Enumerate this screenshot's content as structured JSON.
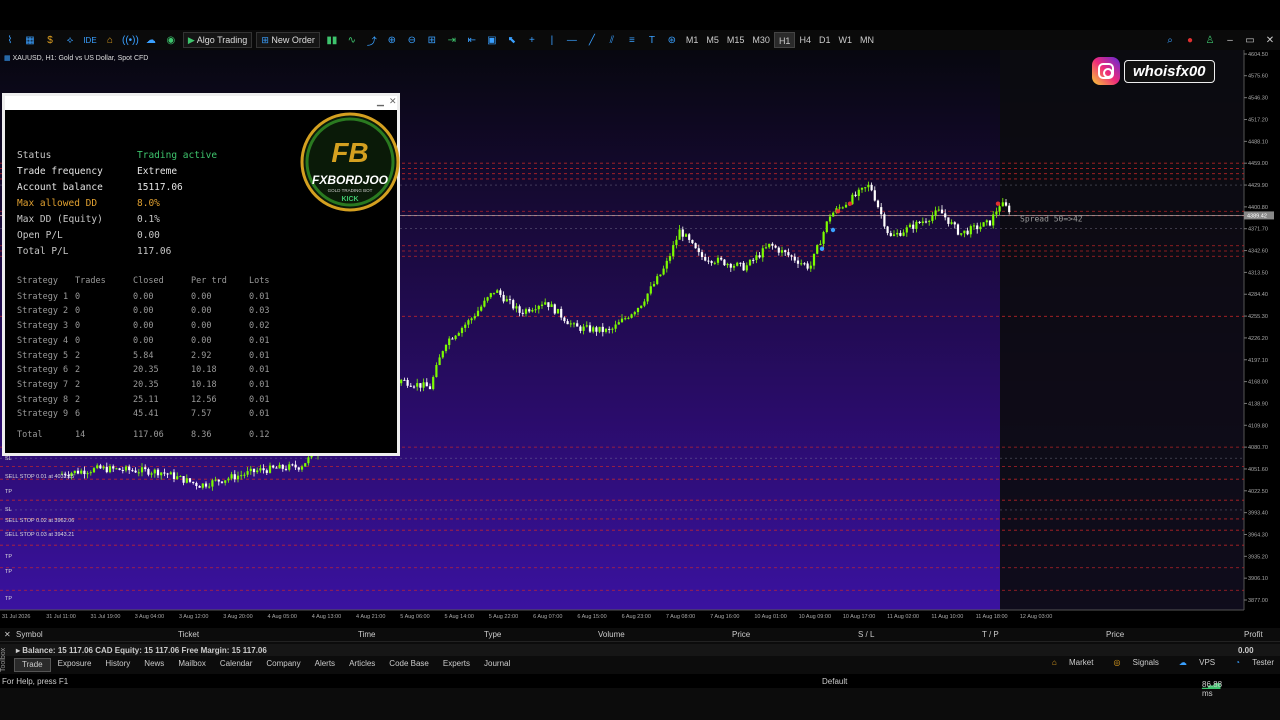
{
  "toolbar": {
    "algo_label": "Algo Trading",
    "neworder_label": "New Order",
    "timeframes": [
      "M1",
      "M5",
      "M15",
      "M30",
      "H1",
      "H4",
      "D1",
      "W1",
      "MN"
    ],
    "active_tf": "H1"
  },
  "chart": {
    "symbol_info": "XAUUSD, H1:  Gold vs US Dollar, Spot CFD",
    "price_ticks": [
      "4604.50",
      "4575.60",
      "4546.30",
      "4517.20",
      "4488.10",
      "4459.00",
      "4429.90",
      "4400.80",
      "4371.70",
      "4342.60",
      "4313.50",
      "4284.40",
      "4255.30",
      "4226.20",
      "4197.10",
      "4168.00",
      "4138.90",
      "4109.80",
      "4080.70",
      "4051.60",
      "4022.50",
      "3993.40",
      "3964.30",
      "3935.20",
      "3906.10",
      "3877.00"
    ],
    "current_price": "4389.42",
    "time_ticks": [
      "31 Jul 2026",
      "31 Jul 11:00",
      "31 Jul 19:00",
      "3 Aug 04:00",
      "3 Aug 12:00",
      "3 Aug 20:00",
      "4 Aug 05:00",
      "4 Aug 13:00",
      "4 Aug 21:00",
      "5 Aug 06:00",
      "5 Aug 14:00",
      "5 Aug 22:00",
      "6 Aug 07:00",
      "6 Aug 15:00",
      "6 Aug 23:00",
      "7 Aug 08:00",
      "7 Aug 16:00",
      "10 Aug 01:00",
      "10 Aug 09:00",
      "10 Aug 17:00",
      "11 Aug 02:00",
      "11 Aug 10:00",
      "11 Aug 18:00",
      "12 Aug 03:00"
    ],
    "spread_label": "Spread 50=>42",
    "order_labels": [
      "SL",
      "SELL STOP 0.01 at 4032.15",
      "TP",
      "SL",
      "SELL STOP 0.02 at 3962.06",
      "SELL STOP 0.03 at 3943.21",
      "TP",
      "TP",
      "TP"
    ],
    "instagram_handle": "whoisfx00"
  },
  "panel": {
    "stats": [
      {
        "k": "Status",
        "v": "Trading active",
        "color": "#c8c8c8",
        "vcolor": "#3ec46d"
      },
      {
        "k": "Trade frequency",
        "v": "Extreme",
        "color": "#e6e6e6",
        "vcolor": "#e6e6e6"
      },
      {
        "k": "Account balance",
        "v": "15117.06",
        "color": "#e6e6e6",
        "vcolor": "#e6e6e6"
      },
      {
        "k": "Max allowed DD",
        "v": "8.0%",
        "color": "#e0a030",
        "vcolor": "#e0a030"
      },
      {
        "k": "Max DD (Equity)",
        "v": "0.1%",
        "color": "#c8c8c8",
        "vcolor": "#c8c8c8"
      },
      {
        "k": "Open P/L",
        "v": "0.00",
        "color": "#c8c8c8",
        "vcolor": "#c8c8c8"
      },
      {
        "k": "Total P/L",
        "v": "117.06",
        "color": "#c8c8c8",
        "vcolor": "#c8c8c8"
      }
    ],
    "strat_headers": [
      "Strategy",
      "Trades",
      "Closed",
      "Per trd",
      "Lots"
    ],
    "strategies": [
      [
        "Strategy 1",
        "0",
        "0.00",
        "0.00",
        "0.01"
      ],
      [
        "Strategy 2",
        "0",
        "0.00",
        "0.00",
        "0.03"
      ],
      [
        "Strategy 3",
        "0",
        "0.00",
        "0.00",
        "0.02"
      ],
      [
        "Strategy 4",
        "0",
        "0.00",
        "0.00",
        "0.01"
      ],
      [
        "Strategy 5",
        "2",
        "5.84",
        "2.92",
        "0.01"
      ],
      [
        "Strategy 6",
        "2",
        "20.35",
        "10.18",
        "0.01"
      ],
      [
        "Strategy 7",
        "2",
        "20.35",
        "10.18",
        "0.01"
      ],
      [
        "Strategy 8",
        "2",
        "25.11",
        "12.56",
        "0.01"
      ],
      [
        "Strategy 9",
        "6",
        "45.41",
        "7.57",
        "0.01"
      ]
    ],
    "total_row": [
      "Total",
      "14",
      "117.06",
      "8.36",
      "0.12"
    ],
    "logo_text": "FXBORDJOO",
    "logo_sub": "GOLD TRADING BOT",
    "logo_kick": "KICK"
  },
  "terminal": {
    "headers": [
      "Symbol",
      "Ticket",
      "Time",
      "Type",
      "Volume",
      "Price",
      "S / L",
      "T / P",
      "Price",
      "Profit"
    ],
    "balance_line": "Balance: 15 117.06 CAD  Equity: 15 117.06  Free Margin: 15 117.06",
    "balance_profit": "0.00",
    "tabs": [
      "Trade",
      "Exposure",
      "History",
      "News",
      "Mailbox",
      "Calendar",
      "Company",
      "Alerts",
      "Articles",
      "Code Base",
      "Experts",
      "Journal"
    ],
    "right_tabs": [
      "Market",
      "Signals",
      "VPS",
      "Tester"
    ],
    "toolbox_label": "Toolbox"
  },
  "status": {
    "help": "For Help, press F1",
    "profile": "Default",
    "ping": "86.88 ms"
  }
}
